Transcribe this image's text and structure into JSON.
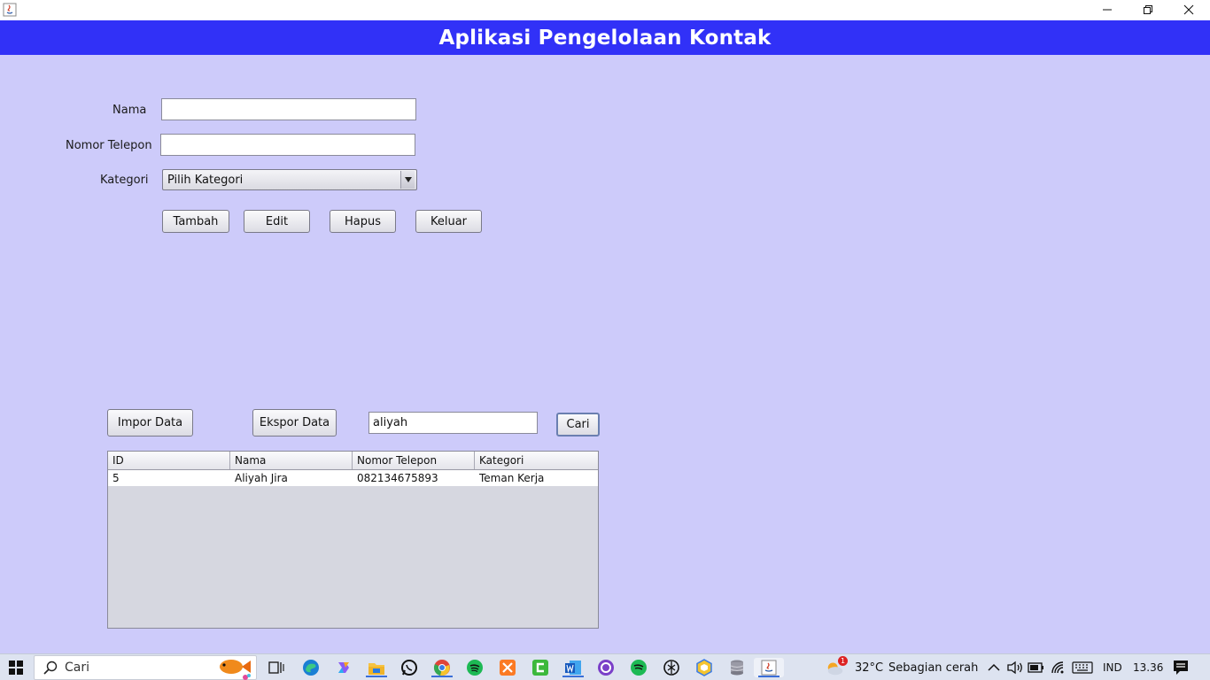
{
  "window": {
    "icon": "java-icon",
    "controls": [
      "minimize-icon",
      "restore-icon",
      "close-icon"
    ]
  },
  "header": {
    "title": "Aplikasi Pengelolaan Kontak"
  },
  "form": {
    "nama_label": "Nama",
    "nama_value": "",
    "telepon_label": "Nomor Telepon",
    "telepon_value": "",
    "kategori_label": "Kategori",
    "kategori_selected": "Pilih Kategori"
  },
  "actions": {
    "tambah": "Tambah",
    "edit": "Edit",
    "hapus": "Hapus",
    "keluar": "Keluar"
  },
  "data_actions": {
    "impor": "Impor Data",
    "ekspor": "Ekspor Data",
    "search_value": "aliyah",
    "cari": "Cari"
  },
  "table": {
    "columns": [
      "ID",
      "Nama",
      "Nomor Telepon",
      "Kategori"
    ],
    "rows": [
      [
        "5",
        "Aliyah Jira",
        "082134675893",
        "Teman Kerja"
      ]
    ]
  },
  "taskbar": {
    "search_placeholder": "Cari",
    "weather_badge": "1",
    "temperature": "32°C",
    "weather_text": "Sebagian cerah",
    "language": "IND",
    "time": "13.36"
  },
  "colors": {
    "header_bg": "#3131f7",
    "panel_bg": "#cdcbfa",
    "table_empty_bg": "#d6d7e0"
  }
}
